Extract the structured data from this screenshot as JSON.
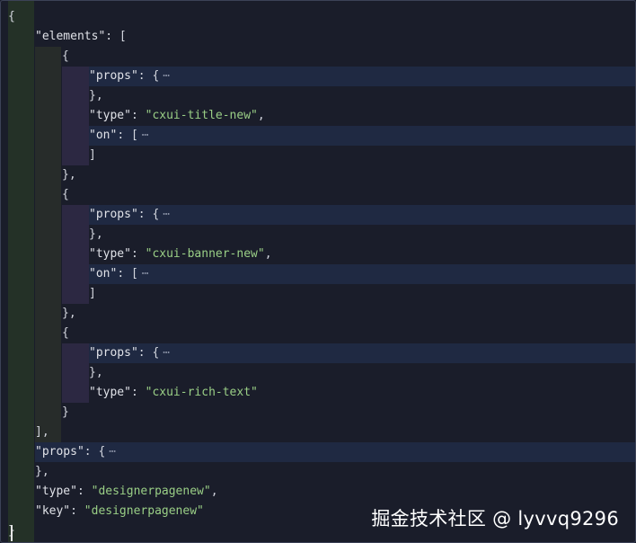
{
  "colors": {
    "background": "#1a1d2a",
    "punctuation": "#d3d6de",
    "key": "#e0e2e8",
    "string": "#9acf86",
    "fold_ellipsis": "#8b93a7",
    "highlight": "#1f2942",
    "guide_level1": "#243127",
    "guide_level2": "#272c2a",
    "guide_level3": "#2c2842"
  },
  "editor": {
    "lines": [
      {
        "tokens": [
          {
            "t": "{",
            "c": "p"
          }
        ]
      },
      {
        "tokens": [
          {
            "t": "\"elements\"",
            "c": "k"
          },
          {
            "t": ": [",
            "c": "p"
          }
        ]
      },
      {
        "tokens": [
          {
            "t": "{",
            "c": "p"
          }
        ]
      },
      {
        "tokens": [
          {
            "t": "\"props\"",
            "c": "k"
          },
          {
            "t": ": {",
            "c": "p"
          }
        ],
        "folded": true
      },
      {
        "tokens": [
          {
            "t": "},",
            "c": "p"
          }
        ]
      },
      {
        "tokens": [
          {
            "t": "\"type\"",
            "c": "k"
          },
          {
            "t": ": ",
            "c": "p"
          },
          {
            "t": "\"cxui-title-new\"",
            "c": "s"
          },
          {
            "t": ",",
            "c": "p"
          }
        ]
      },
      {
        "tokens": [
          {
            "t": "\"on\"",
            "c": "k"
          },
          {
            "t": ": [",
            "c": "p"
          }
        ],
        "folded": true
      },
      {
        "tokens": [
          {
            "t": "]",
            "c": "p"
          }
        ]
      },
      {
        "tokens": [
          {
            "t": "},",
            "c": "p"
          }
        ]
      },
      {
        "tokens": [
          {
            "t": "{",
            "c": "p"
          }
        ]
      },
      {
        "tokens": [
          {
            "t": "\"props\"",
            "c": "k"
          },
          {
            "t": ": {",
            "c": "p"
          }
        ],
        "folded": true
      },
      {
        "tokens": [
          {
            "t": "},",
            "c": "p"
          }
        ]
      },
      {
        "tokens": [
          {
            "t": "\"type\"",
            "c": "k"
          },
          {
            "t": ": ",
            "c": "p"
          },
          {
            "t": "\"cxui-banner-new\"",
            "c": "s"
          },
          {
            "t": ",",
            "c": "p"
          }
        ]
      },
      {
        "tokens": [
          {
            "t": "\"on\"",
            "c": "k"
          },
          {
            "t": ": [",
            "c": "p"
          }
        ],
        "folded": true
      },
      {
        "tokens": [
          {
            "t": "]",
            "c": "p"
          }
        ]
      },
      {
        "tokens": [
          {
            "t": "},",
            "c": "p"
          }
        ]
      },
      {
        "tokens": [
          {
            "t": "{",
            "c": "p"
          }
        ]
      },
      {
        "tokens": [
          {
            "t": "\"props\"",
            "c": "k"
          },
          {
            "t": ": {",
            "c": "p"
          }
        ],
        "folded": true
      },
      {
        "tokens": [
          {
            "t": "},",
            "c": "p"
          }
        ]
      },
      {
        "tokens": [
          {
            "t": "\"type\"",
            "c": "k"
          },
          {
            "t": ": ",
            "c": "p"
          },
          {
            "t": "\"cxui-rich-text\"",
            "c": "s"
          }
        ]
      },
      {
        "tokens": [
          {
            "t": "}",
            "c": "p"
          }
        ]
      },
      {
        "tokens": [
          {
            "t": "],",
            "c": "p"
          }
        ]
      },
      {
        "tokens": [
          {
            "t": "\"props\"",
            "c": "k"
          },
          {
            "t": ": {",
            "c": "p"
          }
        ],
        "folded": true
      },
      {
        "tokens": [
          {
            "t": "},",
            "c": "p"
          }
        ]
      },
      {
        "tokens": [
          {
            "t": "\"type\"",
            "c": "k"
          },
          {
            "t": ": ",
            "c": "p"
          },
          {
            "t": "\"designerpagenew\"",
            "c": "s"
          },
          {
            "t": ",",
            "c": "p"
          }
        ]
      },
      {
        "tokens": [
          {
            "t": "\"key\"",
            "c": "k"
          },
          {
            "t": ": ",
            "c": "p"
          },
          {
            "t": "\"designerpagenew\"",
            "c": "s"
          }
        ]
      },
      {
        "tokens": [
          {
            "t": "}",
            "c": "p"
          }
        ]
      }
    ],
    "fold_ellipsis": "⋯"
  },
  "watermark": {
    "text": "掘金技术社区 @ lyvvq9296"
  }
}
